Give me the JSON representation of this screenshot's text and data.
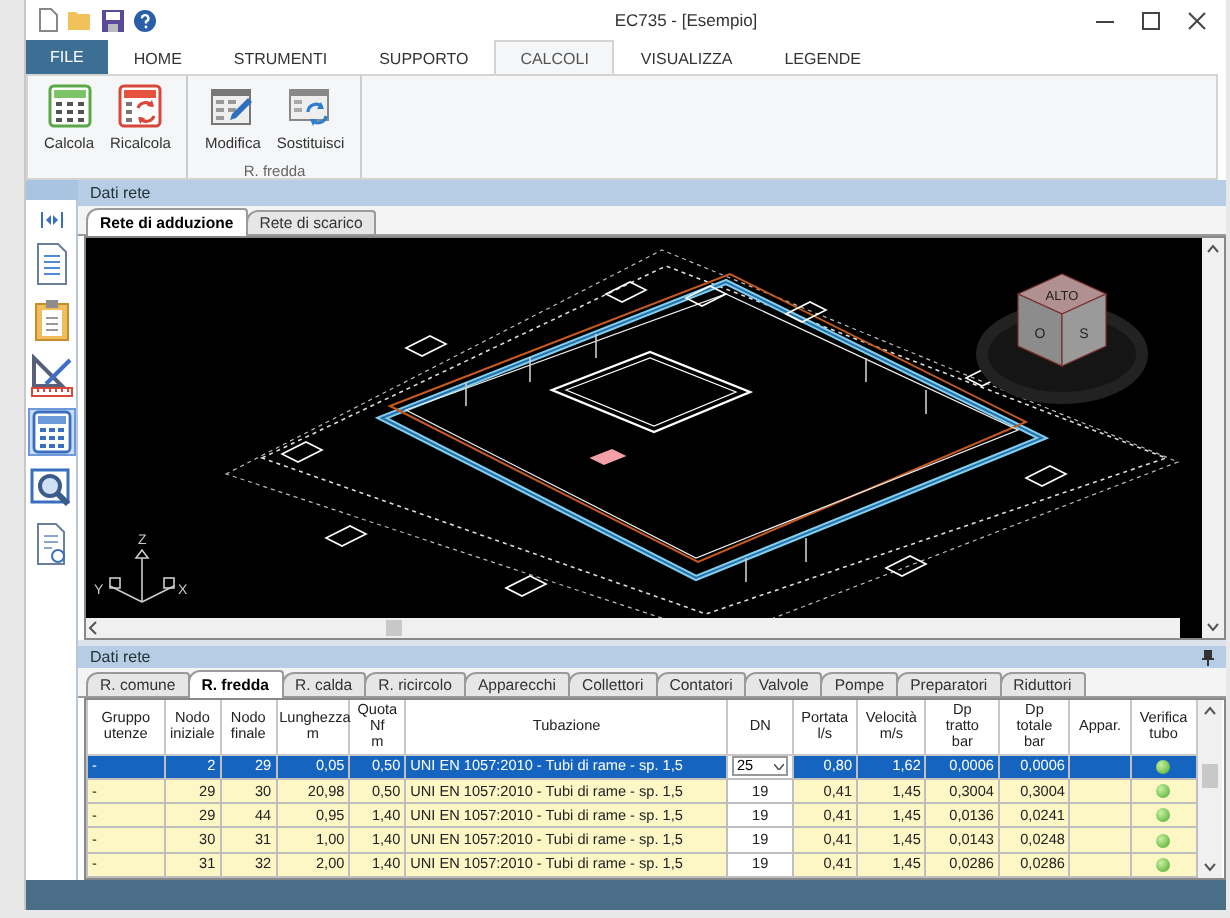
{
  "window": {
    "title": "EC735 - [Esempio]"
  },
  "ribbon": {
    "file_tab": "FILE",
    "tabs": [
      {
        "label": "HOME",
        "selected": false
      },
      {
        "label": "STRUMENTI",
        "selected": false
      },
      {
        "label": "SUPPORTO",
        "selected": false
      },
      {
        "label": "CALCOLI",
        "selected": true
      },
      {
        "label": "VISUALIZZA",
        "selected": false
      },
      {
        "label": "LEGENDE",
        "selected": false
      }
    ],
    "groups": [
      {
        "buttons": [
          {
            "label": "Calcola",
            "kind": "calculate"
          },
          {
            "label": "Ricalcola",
            "kind": "recalculate"
          }
        ]
      },
      {
        "label": "R. fredda",
        "buttons": [
          {
            "label": "Modifica",
            "kind": "edit"
          },
          {
            "label": "Sostituisci",
            "kind": "replace"
          }
        ]
      }
    ]
  },
  "sidebar": {
    "items": [
      {
        "kind": "collapse",
        "selected": false
      },
      {
        "kind": "document",
        "selected": false
      },
      {
        "kind": "clipboard",
        "selected": false
      },
      {
        "kind": "drafting",
        "selected": false
      },
      {
        "kind": "calculator",
        "selected": true
      },
      {
        "kind": "preview",
        "selected": false
      },
      {
        "kind": "report",
        "selected": false
      }
    ]
  },
  "top_panel": {
    "title": "Dati rete",
    "tabs": [
      {
        "label": "Rete di adduzione",
        "selected": true
      },
      {
        "label": "Rete di scarico",
        "selected": false
      }
    ],
    "view": {
      "cube_top": "ALTO",
      "cube_left": "O",
      "cube_right": "S",
      "axis_x": "X",
      "axis_y": "Y",
      "axis_z": "Z"
    }
  },
  "bottom_panel": {
    "title": "Dati rete",
    "tabs": [
      {
        "label": "R. comune",
        "selected": false
      },
      {
        "label": "R. fredda",
        "selected": true
      },
      {
        "label": "R. calda",
        "selected": false
      },
      {
        "label": "R. ricircolo",
        "selected": false
      },
      {
        "label": "Apparecchi",
        "selected": false
      },
      {
        "label": "Collettori",
        "selected": false
      },
      {
        "label": "Contatori",
        "selected": false
      },
      {
        "label": "Valvole",
        "selected": false
      },
      {
        "label": "Pompe",
        "selected": false
      },
      {
        "label": "Preparatori",
        "selected": false
      },
      {
        "label": "Riduttori",
        "selected": false
      }
    ],
    "table": {
      "columns": [
        "Gruppo\nutenze",
        "Nodo\niniziale",
        "Nodo\nfinale",
        "Lunghezza\nm",
        "Quota\nNf\nm",
        "Tubazione",
        "DN",
        "Portata\nl/s",
        "Velocità\nm/s",
        "Dp\ntratto\nbar",
        "Dp\ntotale\nbar",
        "Appar.",
        "Verifica\ntubo"
      ],
      "rows": [
        {
          "selected": true,
          "group": "-",
          "start_node": "2",
          "end_node": "29",
          "length": "0,05",
          "quota": "0,50",
          "pipe": "UNI EN 1057:2010 - Tubi di rame - sp. 1,5",
          "dn": "25",
          "flow": "0,80",
          "velocity": "1,62",
          "dp_segment": "0,0006",
          "dp_total": "0,0006",
          "tube_ok": true
        },
        {
          "selected": false,
          "group": "-",
          "start_node": "29",
          "end_node": "30",
          "length": "20,98",
          "quota": "0,50",
          "pipe": "UNI EN 1057:2010 - Tubi di rame - sp. 1,5",
          "dn": "19",
          "flow": "0,41",
          "velocity": "1,45",
          "dp_segment": "0,3004",
          "dp_total": "0,3004",
          "tube_ok": true
        },
        {
          "selected": false,
          "group": "-",
          "start_node": "29",
          "end_node": "44",
          "length": "0,95",
          "quota": "1,40",
          "pipe": "UNI EN 1057:2010 - Tubi di rame - sp. 1,5",
          "dn": "19",
          "flow": "0,41",
          "velocity": "1,45",
          "dp_segment": "0,0136",
          "dp_total": "0,0241",
          "tube_ok": true
        },
        {
          "selected": false,
          "group": "-",
          "start_node": "30",
          "end_node": "31",
          "length": "1,00",
          "quota": "1,40",
          "pipe": "UNI EN 1057:2010 - Tubi di rame - sp. 1,5",
          "dn": "19",
          "flow": "0,41",
          "velocity": "1,45",
          "dp_segment": "0,0143",
          "dp_total": "0,0248",
          "tube_ok": true
        },
        {
          "selected": false,
          "group": "-",
          "start_node": "31",
          "end_node": "32",
          "length": "2,00",
          "quota": "1,40",
          "pipe": "UNI EN 1057:2010 - Tubi di rame - sp. 1,5",
          "dn": "19",
          "flow": "0,41",
          "velocity": "1,45",
          "dp_segment": "0,0286",
          "dp_total": "0,0286",
          "tube_ok": true
        }
      ]
    }
  }
}
